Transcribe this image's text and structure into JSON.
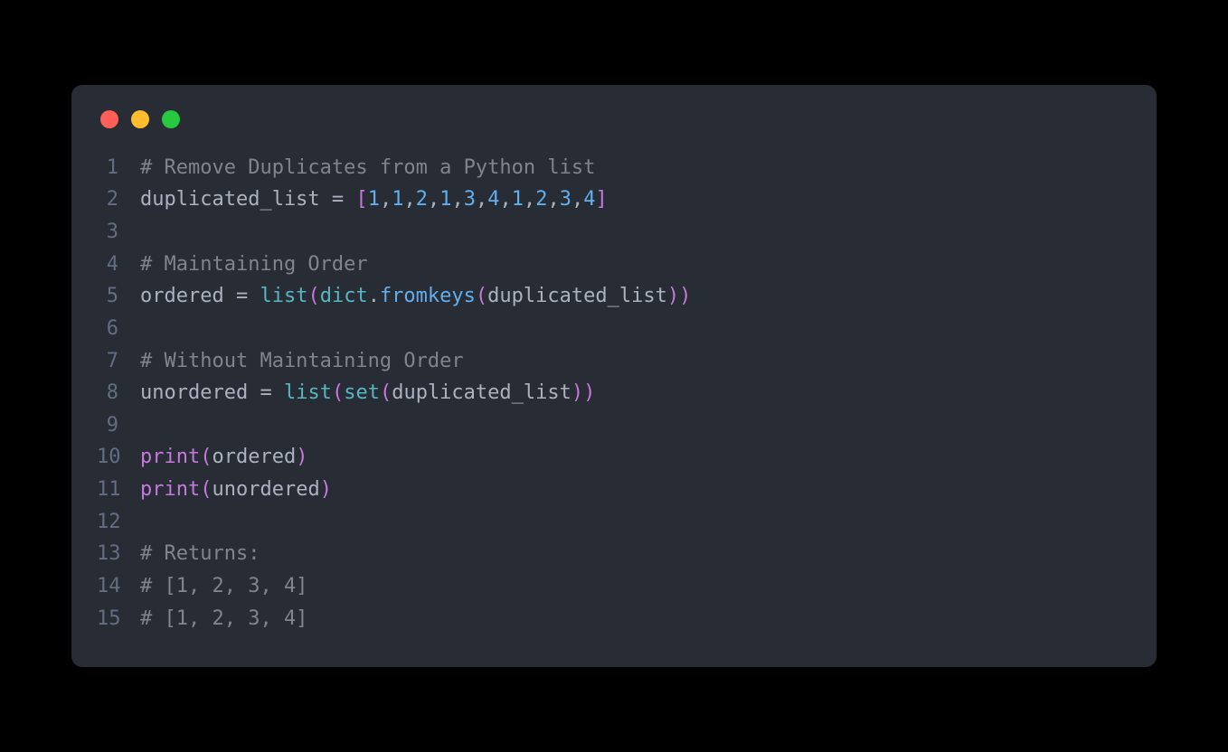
{
  "traffic_lights": {
    "red": "#ff5f56",
    "yellow": "#ffbd2e",
    "green": "#27c93f"
  },
  "code": {
    "lines": [
      {
        "n": "1",
        "tokens": [
          [
            "comment",
            "# Remove Duplicates from a Python list"
          ]
        ]
      },
      {
        "n": "2",
        "tokens": [
          [
            "ident",
            "duplicated_list"
          ],
          [
            "op",
            " = "
          ],
          [
            "bracket",
            "["
          ],
          [
            "number",
            "1"
          ],
          [
            "punct",
            ","
          ],
          [
            "number",
            "1"
          ],
          [
            "punct",
            ","
          ],
          [
            "number",
            "2"
          ],
          [
            "punct",
            ","
          ],
          [
            "number",
            "1"
          ],
          [
            "punct",
            ","
          ],
          [
            "number",
            "3"
          ],
          [
            "punct",
            ","
          ],
          [
            "number",
            "4"
          ],
          [
            "punct",
            ","
          ],
          [
            "number",
            "1"
          ],
          [
            "punct",
            ","
          ],
          [
            "number",
            "2"
          ],
          [
            "punct",
            ","
          ],
          [
            "number",
            "3"
          ],
          [
            "punct",
            ","
          ],
          [
            "number",
            "4"
          ],
          [
            "bracket",
            "]"
          ]
        ]
      },
      {
        "n": "3",
        "tokens": []
      },
      {
        "n": "4",
        "tokens": [
          [
            "comment",
            "# Maintaining Order"
          ]
        ]
      },
      {
        "n": "5",
        "tokens": [
          [
            "ident",
            "ordered"
          ],
          [
            "op",
            " = "
          ],
          [
            "builtin",
            "list"
          ],
          [
            "bracket",
            "("
          ],
          [
            "builtin",
            "dict"
          ],
          [
            "punct",
            "."
          ],
          [
            "method",
            "fromkeys"
          ],
          [
            "bracket",
            "("
          ],
          [
            "ident",
            "duplicated_list"
          ],
          [
            "bracket",
            ")"
          ],
          [
            "bracket",
            ")"
          ]
        ]
      },
      {
        "n": "6",
        "tokens": []
      },
      {
        "n": "7",
        "tokens": [
          [
            "comment",
            "# Without Maintaining Order"
          ]
        ]
      },
      {
        "n": "8",
        "tokens": [
          [
            "ident",
            "unordered"
          ],
          [
            "op",
            " = "
          ],
          [
            "builtin",
            "list"
          ],
          [
            "bracket",
            "("
          ],
          [
            "builtin",
            "set"
          ],
          [
            "bracket",
            "("
          ],
          [
            "ident",
            "duplicated_list"
          ],
          [
            "bracket",
            ")"
          ],
          [
            "bracket",
            ")"
          ]
        ]
      },
      {
        "n": "9",
        "tokens": []
      },
      {
        "n": "10",
        "tokens": [
          [
            "print",
            "print"
          ],
          [
            "bracket",
            "("
          ],
          [
            "ident",
            "ordered"
          ],
          [
            "bracket",
            ")"
          ]
        ]
      },
      {
        "n": "11",
        "tokens": [
          [
            "print",
            "print"
          ],
          [
            "bracket",
            "("
          ],
          [
            "ident",
            "unordered"
          ],
          [
            "bracket",
            ")"
          ]
        ]
      },
      {
        "n": "12",
        "tokens": []
      },
      {
        "n": "13",
        "tokens": [
          [
            "comment",
            "# Returns:"
          ]
        ]
      },
      {
        "n": "14",
        "tokens": [
          [
            "comment",
            "# [1, 2, 3, 4]"
          ]
        ]
      },
      {
        "n": "15",
        "tokens": [
          [
            "comment",
            "# [1, 2, 3, 4]"
          ]
        ]
      }
    ]
  }
}
